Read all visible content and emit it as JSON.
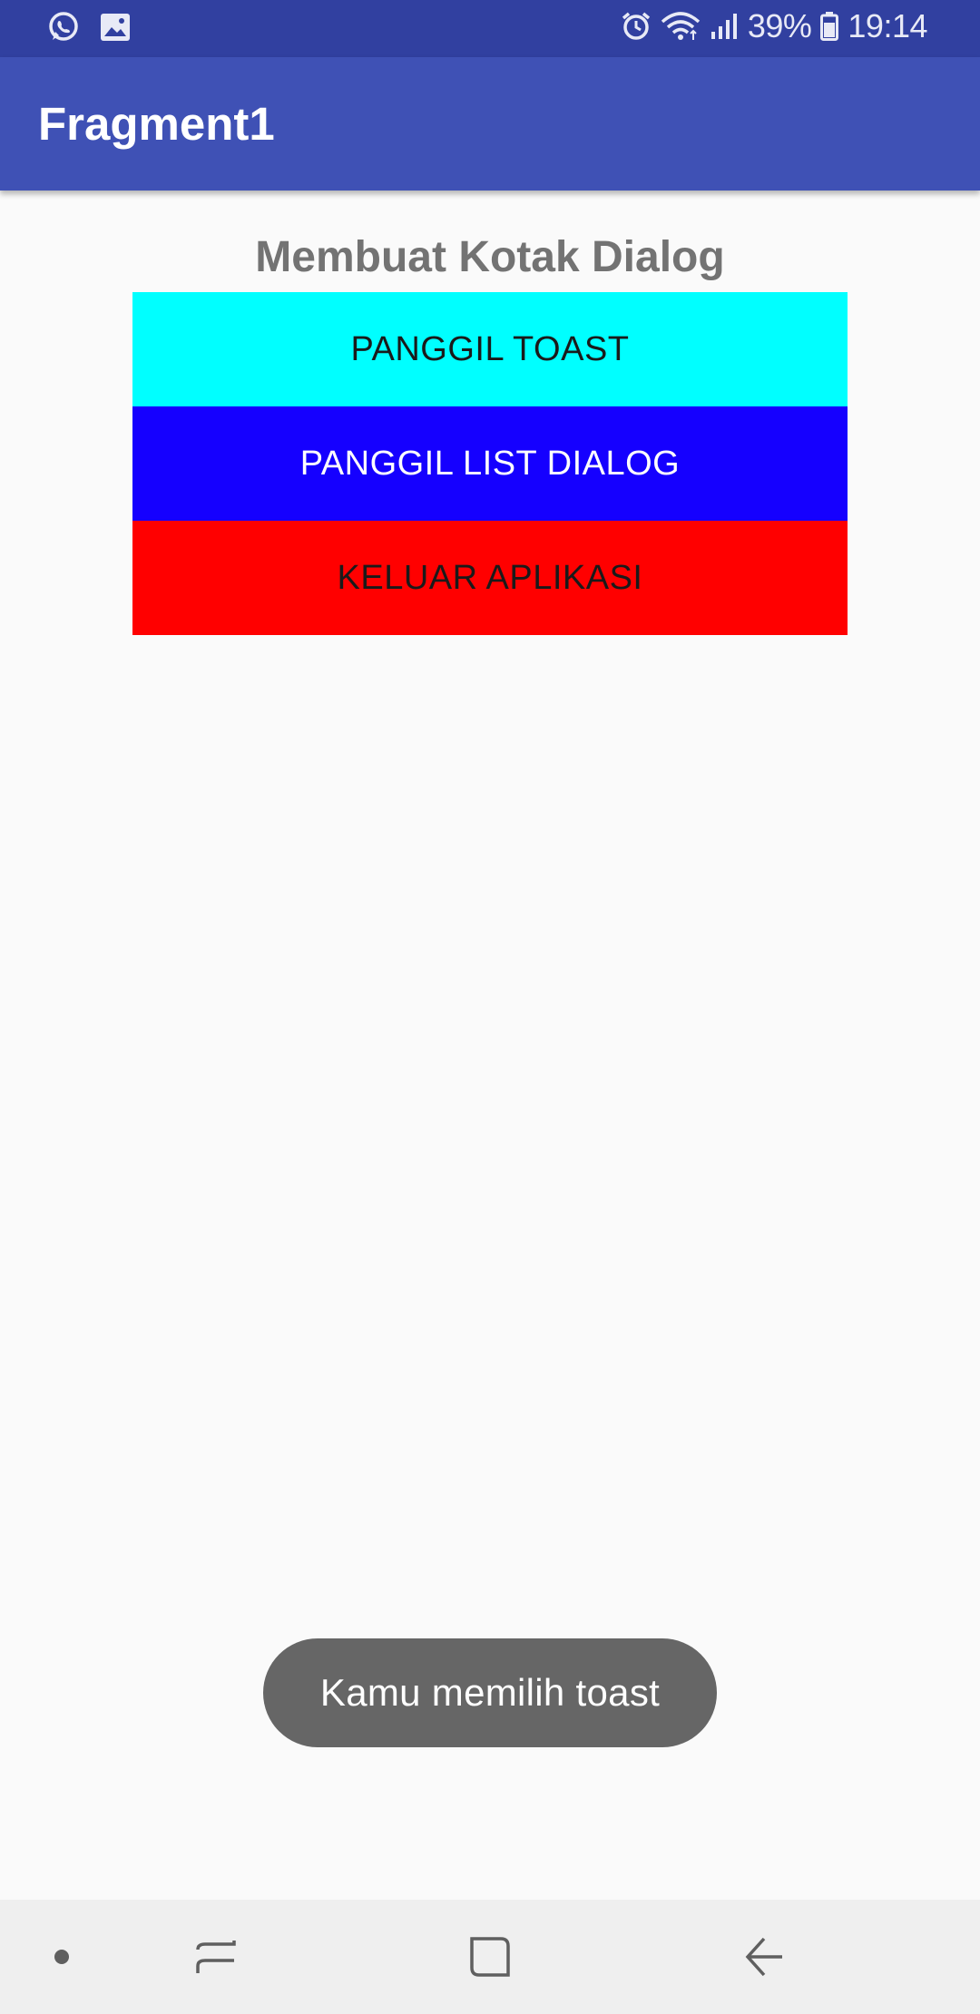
{
  "status_bar": {
    "icons_left": [
      "whatsapp-icon",
      "image-icon"
    ],
    "icons_right": [
      "alarm-icon",
      "wifi-icon",
      "signal-icon"
    ],
    "battery_percent": "39%",
    "time": "19:14"
  },
  "app_bar": {
    "title": "Fragment1"
  },
  "main": {
    "heading": "Membuat Kotak Dialog",
    "buttons": [
      {
        "label": "PANGGIL TOAST",
        "color": "#00ffff"
      },
      {
        "label": "PANGGIL LIST DIALOG",
        "color": "#1500ff"
      },
      {
        "label": "KELUAR APLIKASI",
        "color": "#ff0000"
      }
    ]
  },
  "toast": {
    "message": "Kamu memilih toast"
  },
  "nav_bar": {
    "icons": [
      "dot-icon",
      "recents-icon",
      "home-icon",
      "back-icon"
    ]
  },
  "colors": {
    "status_bar": "#3140a0",
    "app_bar": "#3f51b5",
    "background": "#fafafa",
    "toast": "#666666"
  }
}
